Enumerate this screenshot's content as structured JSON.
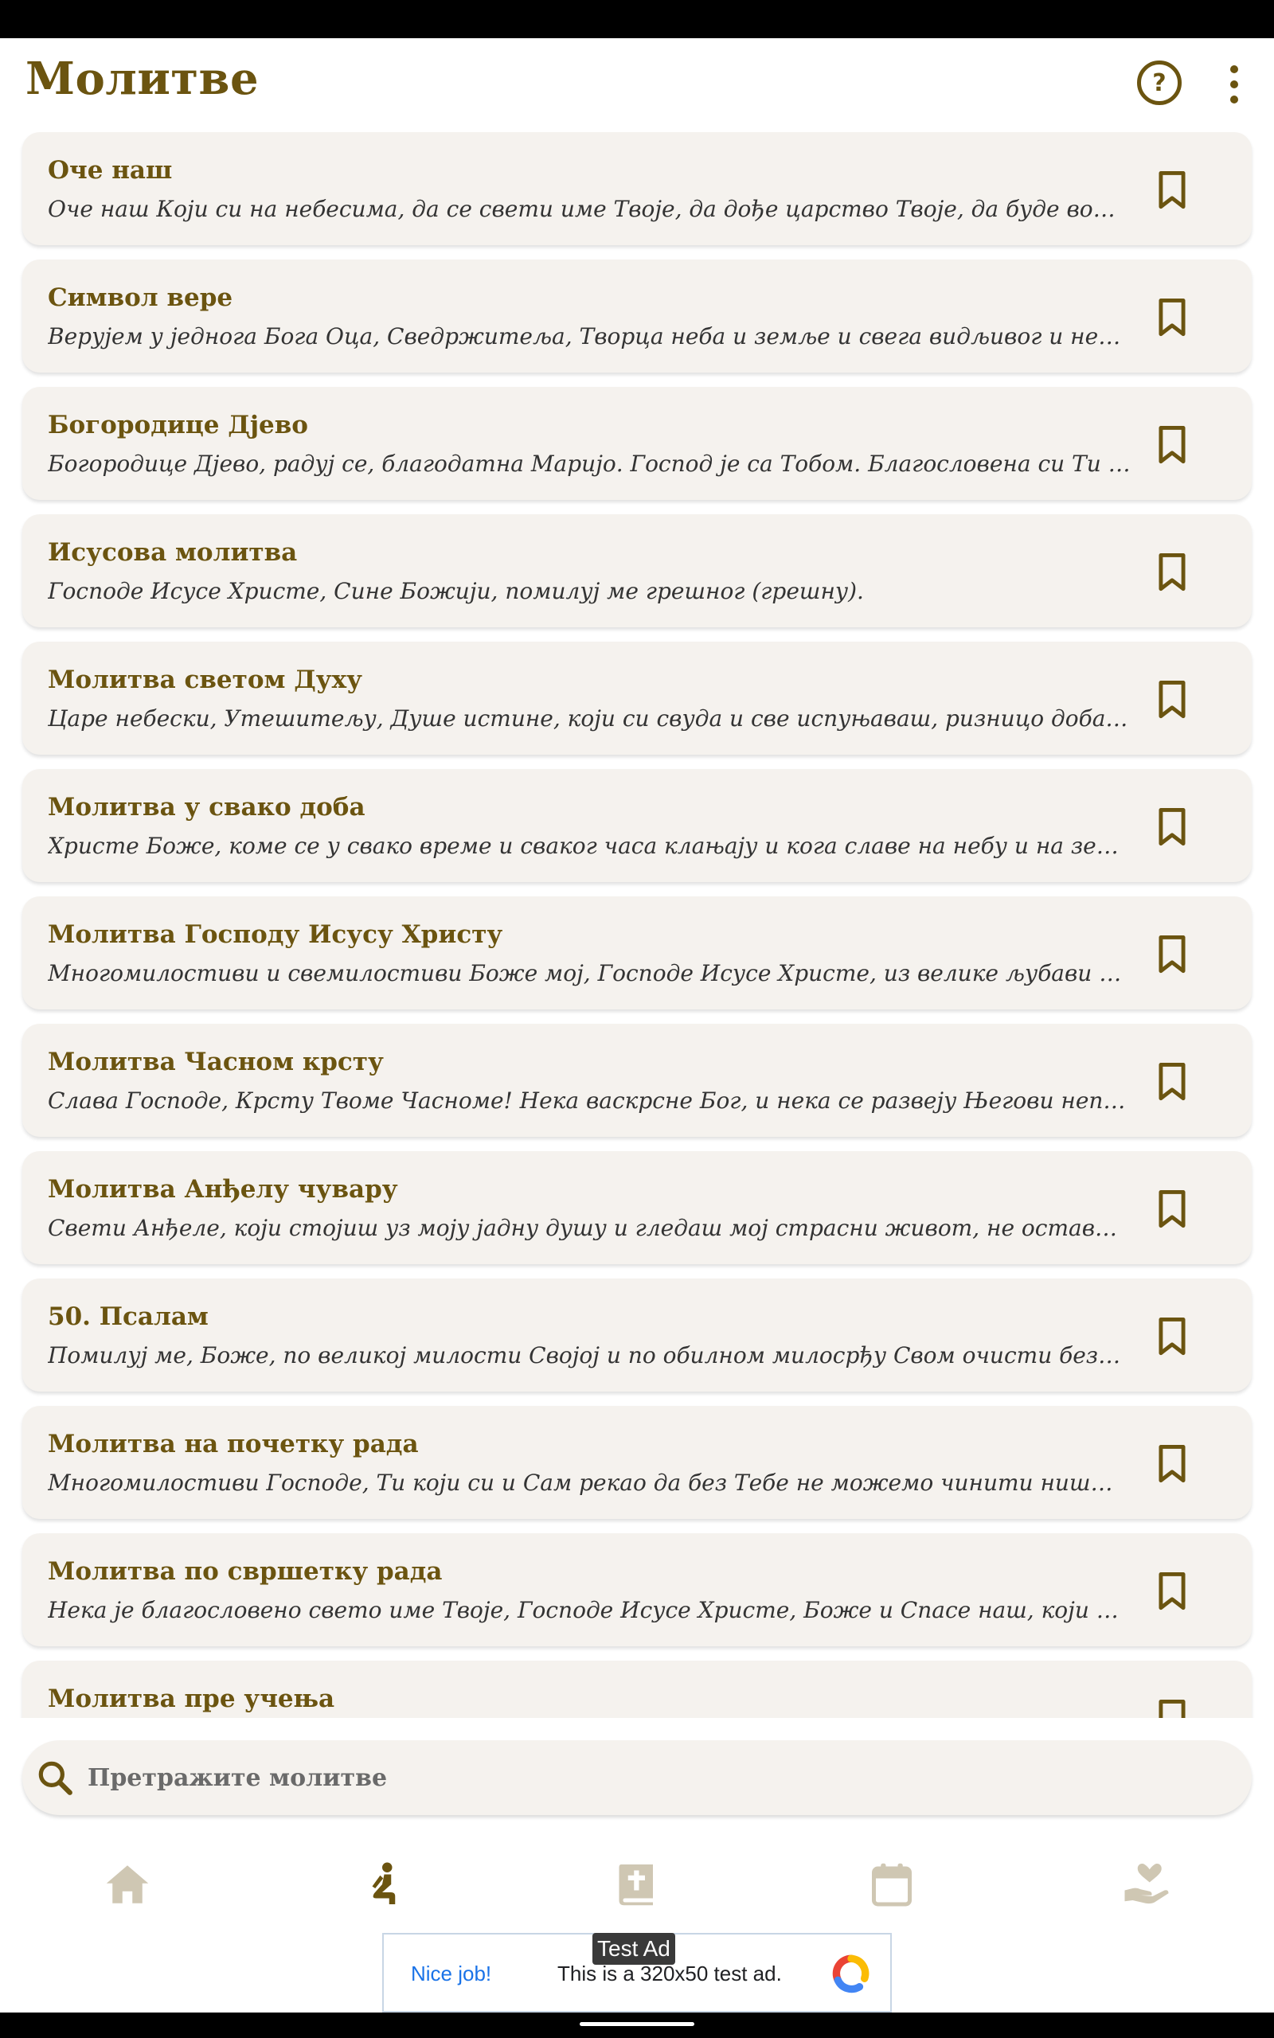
{
  "header": {
    "title": "Молитве",
    "help_label": "?"
  },
  "prayers": [
    {
      "title": "Оче наш",
      "preview": "Оче наш Који си на небесима, да се свети име Твоје, да дође царство Твоје, да буде воља ..."
    },
    {
      "title": "Символ вере",
      "preview": "Верујем у једнога Бога Оца, Сведржитеља, Творца неба и земље и свега видљивог и невид..."
    },
    {
      "title": "Богородице Дјево",
      "preview": "Богородице Дјево, радуј се, благодатна Маријо. Господ је са Тобом. Благословена си Ти ме..."
    },
    {
      "title": "Исусова молитва",
      "preview": "Господе Исусе Христе, Сине Божији, помилуј ме грешног (грешну)."
    },
    {
      "title": "Молитва светом Духу",
      "preview": "Царе небески, Утешитељу, Душе истине, који си свуда и све испуњаваш, ризницо добар..."
    },
    {
      "title": "Молитва у свако доба",
      "preview": "Христе Боже, коме се у свако време и сваког часа клањају и кога славе на небу и на земљи..."
    },
    {
      "title": "Молитва Господу Исусу Христу",
      "preview": "Многомилостиви и свемилостиви Боже мој, Господе Исусе Христе, из велике љубави си..."
    },
    {
      "title": "Молитва Часном крсту",
      "preview": "Слава Господе, Крсту Твоме Часноме! Нека васкрсне Бог, и нека се развеју Његови неприј..."
    },
    {
      "title": "Молитва Анђелу чувару",
      "preview": "Свети Анђеле, који стојиш уз моју јадну душу и гледаш мој страсни живот, не остави ..."
    },
    {
      "title": "50. Псалам",
      "preview": "Помилуј ме, Боже, по великој милости Својој и по обилном милосрђу Свом очисти безако..."
    },
    {
      "title": "Молитва на почетку рада",
      "preview": "Многомилостиви Господе, Ти који си и Сам рекао да без Тебе не можемо чинити ништа ..."
    },
    {
      "title": "Молитва по свршетку рада",
      "preview": "Нека је благословено свето име Твоје, Господе Исусе Христе, Боже и Спасе наш, који си у..."
    },
    {
      "title": "Молитва пре учења",
      "preview": ""
    }
  ],
  "search": {
    "placeholder": "Претражите молитве"
  },
  "nav": {
    "items": [
      {
        "icon": "home-icon",
        "active": false
      },
      {
        "icon": "praying-person-icon",
        "active": true
      },
      {
        "icon": "bible-icon",
        "active": false
      },
      {
        "icon": "calendar-icon",
        "active": false
      },
      {
        "icon": "helping-hand-heart-icon",
        "active": false
      }
    ]
  },
  "ad": {
    "tag": "Test Ad",
    "cta": "Nice job!",
    "text": "This is a 320x50 test ad."
  },
  "colors": {
    "accent": "#6b5410",
    "inactive_icon": "#cfc7b3",
    "card_bg": "#f5f2ee"
  }
}
